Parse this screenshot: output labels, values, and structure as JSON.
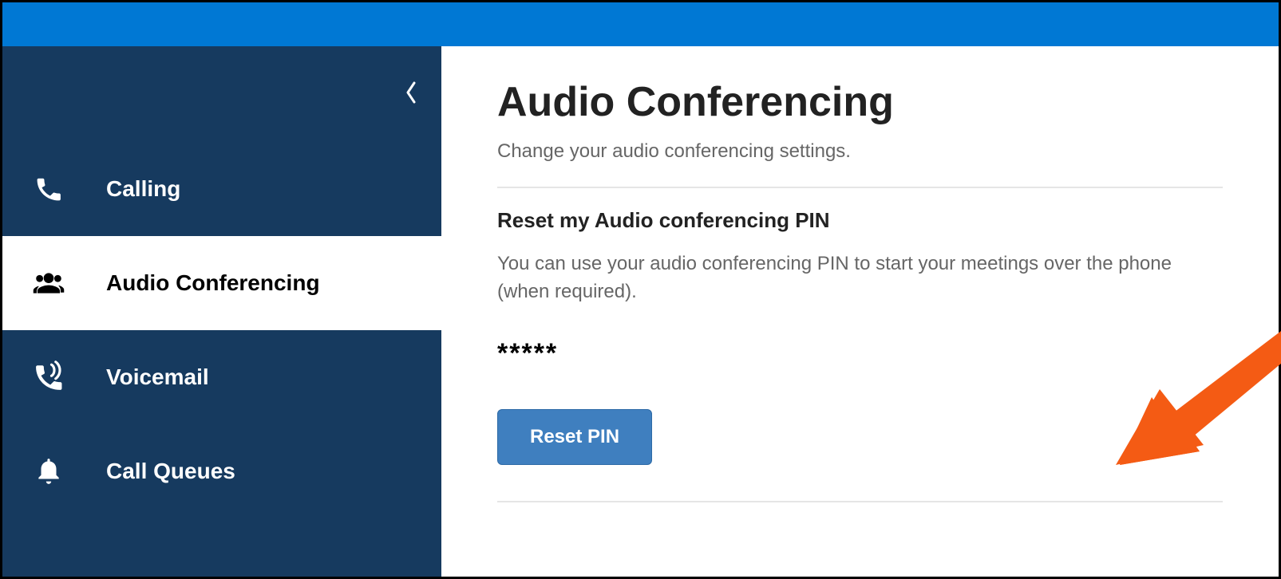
{
  "sidebar": {
    "items": [
      {
        "label": "Calling"
      },
      {
        "label": "Audio Conferencing"
      },
      {
        "label": "Voicemail"
      },
      {
        "label": "Call Queues"
      }
    ]
  },
  "main": {
    "title": "Audio Conferencing",
    "subtitle": "Change your audio conferencing settings.",
    "section_title": "Reset my Audio conferencing PIN",
    "section_desc": "You can use your audio conferencing PIN to start your meetings over the phone (when required).",
    "pin_mask": "*****",
    "reset_button": "Reset PIN"
  }
}
